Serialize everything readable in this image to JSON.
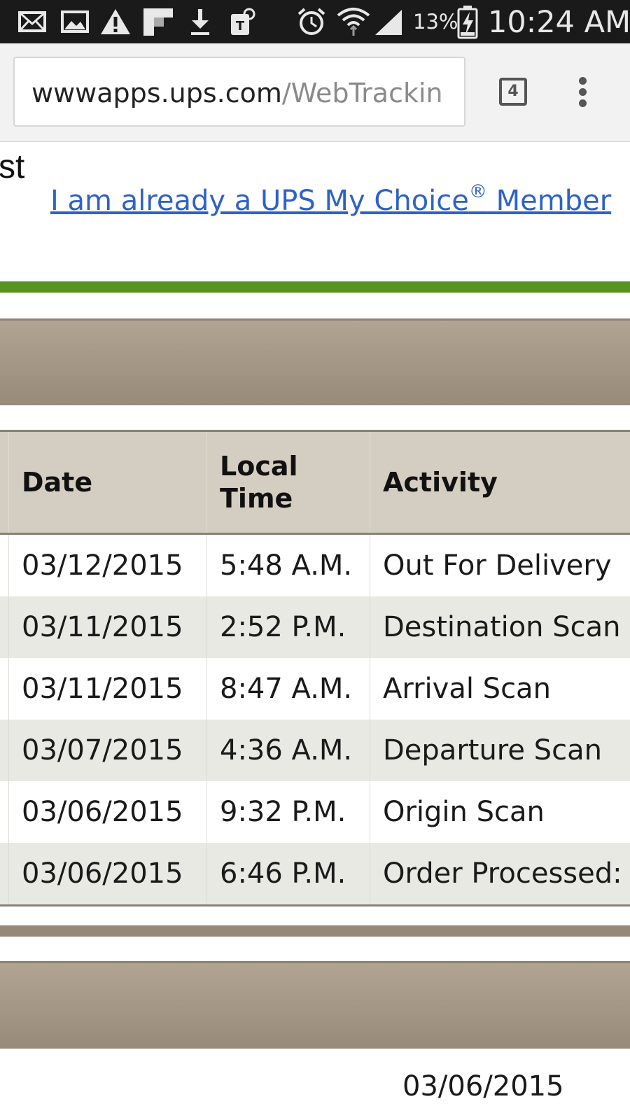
{
  "status_bar": {
    "battery": "13%",
    "time": "10:24 AM",
    "icons": [
      "mail-icon",
      "image-icon",
      "warning-icon",
      "flipboard-icon",
      "download-icon",
      "tmobile-icon",
      "alarm-icon",
      "wifi-icon",
      "signal-icon",
      "battery-charging-icon"
    ]
  },
  "browser": {
    "url_domain": "wwwapps.ups.com",
    "url_path": "/WebTrackin",
    "tab_count": "4",
    "menu_icon": "overflow-menu-icon"
  },
  "page": {
    "title_fragment": "st",
    "member_link": {
      "prefix": "I am already a UPS My Choice",
      "reg": "®",
      "suffix": " Member"
    }
  },
  "table": {
    "headers": {
      "date": "Date",
      "local_time_line1": "Local",
      "local_time_line2": "Time",
      "activity": "Activity"
    },
    "rows": [
      {
        "date": "03/12/2015",
        "time": "5:48 A.M.",
        "activity": "Out For Delivery"
      },
      {
        "date": "03/11/2015",
        "time": "2:52 P.M.",
        "activity": "Destination Scan"
      },
      {
        "date": "03/11/2015",
        "time": "8:47 A.M.",
        "activity": "Arrival Scan"
      },
      {
        "date": "03/07/2015",
        "time": "4:36 A.M.",
        "activity": "Departure Scan"
      },
      {
        "date": "03/06/2015",
        "time": "9:32 P.M.",
        "activity": "Origin Scan"
      },
      {
        "date": "03/06/2015",
        "time": "6:46 P.M.",
        "activity": "Order Processed:"
      }
    ]
  },
  "footer": {
    "date": "03/06/2015"
  },
  "colors": {
    "status_bar_bg": "#1a1a1a",
    "link": "#2f62c8",
    "accent_green": "#5a9420",
    "band_brown": "#978a78",
    "header_tan": "#d4cdc1",
    "alt_row": "#e9e9e4"
  }
}
